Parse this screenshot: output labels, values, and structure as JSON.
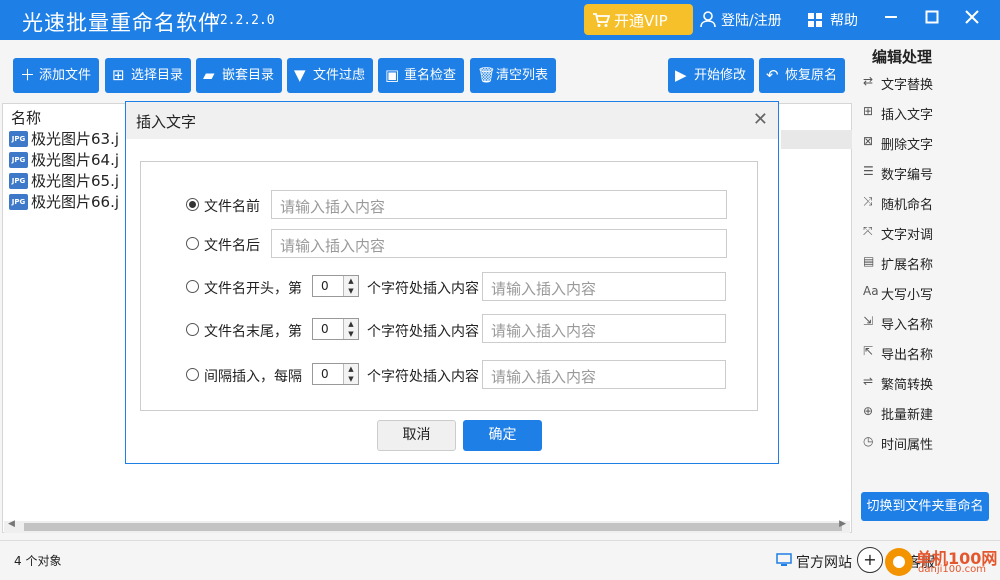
{
  "app": {
    "title": "光速批量重命名软件",
    "version": "V2.2.2.0",
    "vip": "开通VIP",
    "login": "登陆/注册",
    "help": "帮助"
  },
  "toolbar": {
    "add_file": "添加文件",
    "select_dir": "选择目录",
    "nested_dir": "嵌套目录",
    "file_filter": "文件过虑",
    "rename_check": "重名检查",
    "clear_list": "清空列表",
    "start_modify": "开始修改",
    "restore_name": "恢复原名"
  },
  "filelist": {
    "column": "名称",
    "rows": [
      "极光图片63.j",
      "极光图片64.j",
      "极光图片65.j",
      "极光图片66.j"
    ],
    "icon_label": "JPG"
  },
  "panel": {
    "title": "编辑处理",
    "items": [
      "文字替换",
      "插入文字",
      "删除文字",
      "数字编号",
      "随机命名",
      "文字对调",
      "扩展名称",
      "大写小写",
      "导入名称",
      "导出名称",
      "繁简转换",
      "批量新建",
      "时间属性"
    ],
    "switch": "切换到文件夹重命名"
  },
  "status": {
    "count": "4 个对象",
    "site": "官方网站",
    "service": "Q客服"
  },
  "watermark": {
    "text": "单机100网",
    "url": "danji100.com"
  },
  "dialog": {
    "title": "插入文字",
    "options": {
      "before": "文件名前",
      "after": "文件名后",
      "start": "文件名开头，第",
      "end": "文件名末尾，第",
      "interval": "间隔插入，每隔"
    },
    "suffix": "个字符处插入内容",
    "placeholder": "请输入插入内容",
    "spin_value": "0",
    "cancel": "取消",
    "ok": "确定"
  }
}
